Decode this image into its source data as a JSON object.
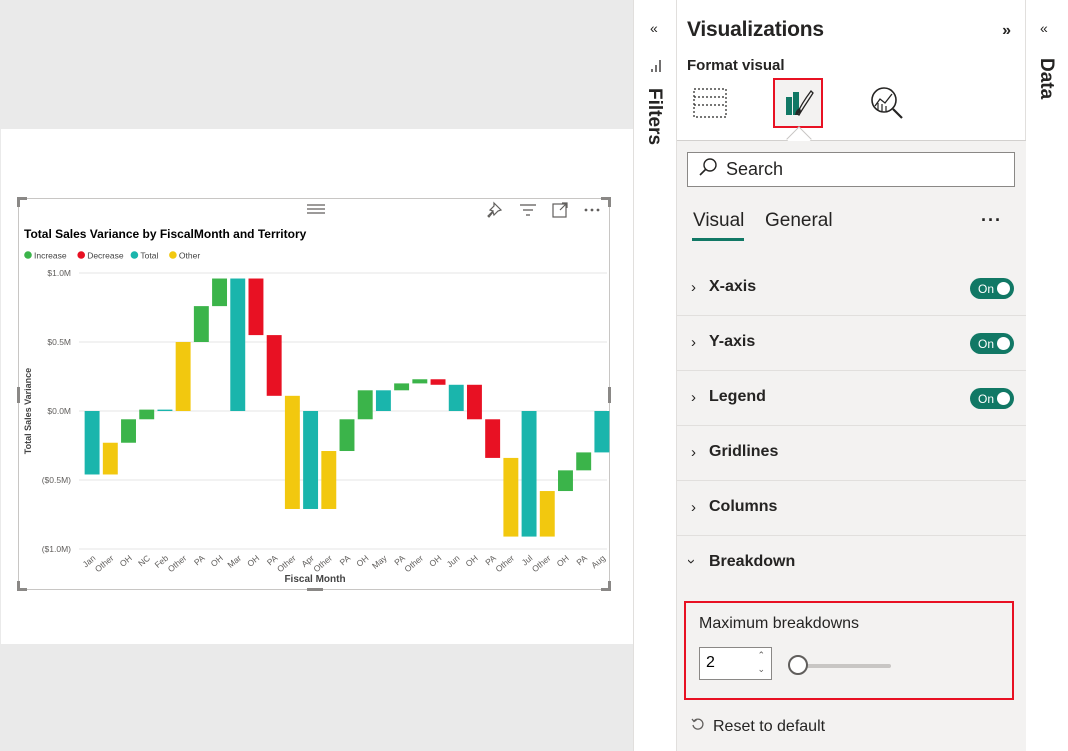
{
  "filters": {
    "label": "Filters",
    "collapse_glyph": "«"
  },
  "data_pane": {
    "label": "Data",
    "collapse_glyph": "«"
  },
  "visualizations": {
    "title": "Visualizations",
    "expand_glyph": "»",
    "format_visual_label": "Format visual",
    "search_placeholder": "Search",
    "subtabs": {
      "visual": "Visual",
      "general": "General",
      "more": "···"
    },
    "cards": [
      {
        "label": "X-axis",
        "toggle": "On",
        "expanded": false
      },
      {
        "label": "Y-axis",
        "toggle": "On",
        "expanded": false
      },
      {
        "label": "Legend",
        "toggle": "On",
        "expanded": false
      },
      {
        "label": "Gridlines",
        "expanded": false
      },
      {
        "label": "Columns",
        "expanded": false
      },
      {
        "label": "Breakdown",
        "expanded": true
      }
    ],
    "breakdown": {
      "max_label": "Maximum breakdowns",
      "value": "2",
      "slider_fraction": 0.0
    },
    "reset_label": "Reset to default",
    "accent": "#117865",
    "highlight": "#e81123"
  },
  "chart_data": {
    "type": "waterfall",
    "title": "Total Sales Variance by FiscalMonth and Territory",
    "xlabel": "Fiscal Month",
    "ylabel": "Total Sales Variance",
    "ylim": [
      -1.0,
      1.0
    ],
    "yticks": [
      {
        "value": 1.0,
        "label": "$1.0M"
      },
      {
        "value": 0.5,
        "label": "$0.5M"
      },
      {
        "value": 0.0,
        "label": "$0.0M"
      },
      {
        "value": -0.5,
        "label": "($0.5M)"
      },
      {
        "value": -1.0,
        "label": "($1.0M)"
      }
    ],
    "legend": [
      {
        "name": "Increase",
        "color": "#3bb44a"
      },
      {
        "name": "Decrease",
        "color": "#e81123"
      },
      {
        "name": "Total",
        "color": "#1ab5ac"
      },
      {
        "name": "Other",
        "color": "#f2c80f"
      }
    ],
    "bars": [
      {
        "label": "Jan",
        "kind": "Total",
        "start": 0.0,
        "end": -0.46
      },
      {
        "label": "Other",
        "kind": "Other",
        "start": -0.46,
        "end": -0.23
      },
      {
        "label": "OH",
        "kind": "Increase",
        "start": -0.23,
        "end": -0.06
      },
      {
        "label": "NC",
        "kind": "Increase",
        "start": -0.06,
        "end": 0.01
      },
      {
        "label": "Feb",
        "kind": "Total",
        "start": 0.0,
        "end": 0.01
      },
      {
        "label": "Other",
        "kind": "Other",
        "start": 0.0,
        "end": 0.5
      },
      {
        "label": "PA",
        "kind": "Increase",
        "start": 0.5,
        "end": 0.76
      },
      {
        "label": "OH",
        "kind": "Increase",
        "start": 0.76,
        "end": 0.96
      },
      {
        "label": "Mar",
        "kind": "Total",
        "start": 0.0,
        "end": 0.96
      },
      {
        "label": "OH",
        "kind": "Decrease",
        "start": 0.96,
        "end": 0.55
      },
      {
        "label": "PA",
        "kind": "Decrease",
        "start": 0.55,
        "end": 0.11
      },
      {
        "label": "Other",
        "kind": "Other",
        "start": 0.11,
        "end": -0.71
      },
      {
        "label": "Apr",
        "kind": "Total",
        "start": 0.0,
        "end": -0.71
      },
      {
        "label": "Other",
        "kind": "Other",
        "start": -0.71,
        "end": -0.29
      },
      {
        "label": "PA",
        "kind": "Increase",
        "start": -0.29,
        "end": -0.06
      },
      {
        "label": "OH",
        "kind": "Increase",
        "start": -0.06,
        "end": 0.15
      },
      {
        "label": "May",
        "kind": "Total",
        "start": 0.0,
        "end": 0.15
      },
      {
        "label": "PA",
        "kind": "Increase",
        "start": 0.15,
        "end": 0.2
      },
      {
        "label": "Other",
        "kind": "Increase",
        "start": 0.2,
        "end": 0.23
      },
      {
        "label": "OH",
        "kind": "Decrease",
        "start": 0.23,
        "end": 0.19
      },
      {
        "label": "Jun",
        "kind": "Total",
        "start": 0.0,
        "end": 0.19
      },
      {
        "label": "OH",
        "kind": "Decrease",
        "start": 0.19,
        "end": -0.06
      },
      {
        "label": "PA",
        "kind": "Decrease",
        "start": -0.06,
        "end": -0.34
      },
      {
        "label": "Other",
        "kind": "Other",
        "start": -0.34,
        "end": -0.91
      },
      {
        "label": "Jul",
        "kind": "Total",
        "start": 0.0,
        "end": -0.91
      },
      {
        "label": "Other",
        "kind": "Other",
        "start": -0.91,
        "end": -0.58
      },
      {
        "label": "OH",
        "kind": "Increase",
        "start": -0.58,
        "end": -0.43
      },
      {
        "label": "PA",
        "kind": "Increase",
        "start": -0.43,
        "end": -0.3
      },
      {
        "label": "Aug",
        "kind": "Total",
        "start": 0.0,
        "end": -0.3
      }
    ]
  }
}
